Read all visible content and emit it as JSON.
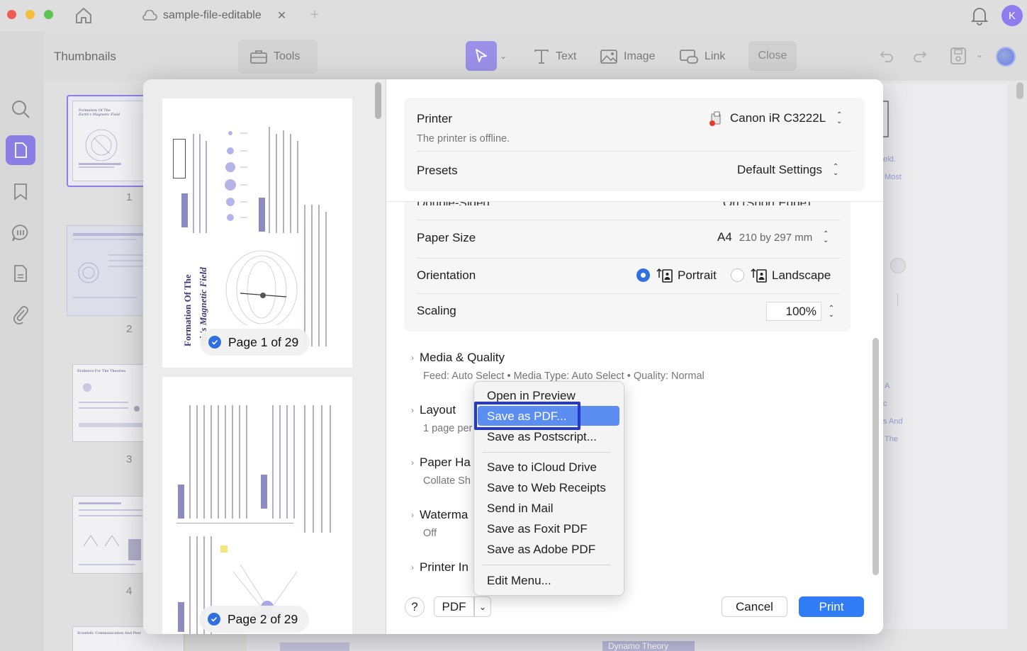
{
  "tabbar": {
    "tab_title": "sample-file-editable",
    "avatar_letter": "K"
  },
  "toolbar": {
    "thumbnails_label": "Thumbnails",
    "tools_label": "Tools",
    "text_label": "Text",
    "image_label": "Image",
    "link_label": "Link",
    "close_label": "Close"
  },
  "thumbnails": {
    "numbers": [
      "1",
      "2",
      "3",
      "4"
    ],
    "page1_title": "Formation Of The",
    "page1_subtitle": "Earth's Magnetic Field",
    "page3_title": "Evidence For The Theories",
    "page5_title": "Scientific Communication And Peer"
  },
  "preview": {
    "page1_label": "Page 1 of 29",
    "page2_label": "Page 2 of 29",
    "page1_title": "Formation Of The",
    "page1_title2": "rth's Magnetic Field"
  },
  "print": {
    "printer_label": "Printer",
    "printer_value": "Canon iR C3222L",
    "printer_status": "The printer is offline.",
    "presets_label": "Presets",
    "presets_value": "Default Settings",
    "double_sided_partial": "Double-Sided",
    "double_sided_value_partial": "On (Short Edge)",
    "paper_size_label": "Paper Size",
    "paper_size_value": "A4",
    "paper_size_dims": "210 by 297 mm",
    "orientation_label": "Orientation",
    "portrait_label": "Portrait",
    "landscape_label": "Landscape",
    "scaling_label": "Scaling",
    "scaling_value": "100%",
    "media_label": "Media & Quality",
    "media_detail": "Feed: Auto Select • Media Type: Auto Select • Quality: Normal",
    "layout_label": "Layout",
    "layout_detail": "1 page per",
    "paper_handling_label": "Paper Ha",
    "paper_handling_detail": "Collate Sh",
    "watermark_label": "Waterma",
    "watermark_detail": "Off",
    "printer_info_label": "Printer In",
    "help_label": "?",
    "pdf_label": "PDF",
    "cancel_label": "Cancel",
    "print_label": "Print"
  },
  "menu": {
    "items": [
      "Open in Preview",
      "Save as PDF...",
      "Save as Postscript...",
      "Save to iCloud Drive",
      "Save to Web Receipts",
      "Send in Mail",
      "Save as Foxit PDF",
      "Save as Adobe PDF",
      "Edit Menu..."
    ]
  },
  "background_right": {
    "fragments": [
      "eld.",
      "Most",
      "A",
      "c",
      "s And",
      "The"
    ],
    "bottom_partial": "Dynamo Theory"
  },
  "colors": {
    "accent": "#2f6fe0",
    "highlight_border": "#2538c8",
    "menu_selected": "#5b8ef0"
  }
}
